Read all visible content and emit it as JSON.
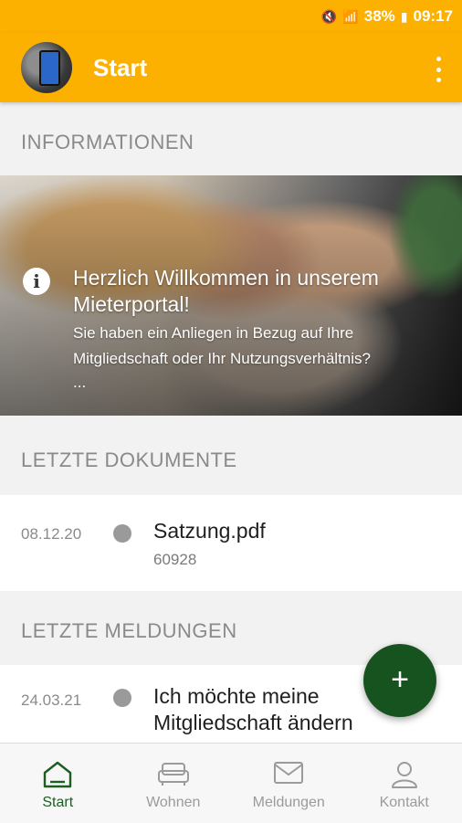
{
  "status": {
    "battery": "38%",
    "time": "09:17"
  },
  "appbar": {
    "title": "Start"
  },
  "sections": {
    "informationen": "INFORMATIONEN",
    "dokumente": "LETZTE DOKUMENTE",
    "meldungen": "LETZTE MELDUNGEN"
  },
  "hero": {
    "title": "Herzlich Willkommen in unserem Mieterportal!",
    "text": "Sie haben ein Anliegen in Bezug auf Ihre Mitgliedschaft oder Ihr Nutzungsverhältnis?",
    "ellipsis": "..."
  },
  "documents": [
    {
      "date": "08.12.20",
      "title": "Satzung.pdf",
      "sub": "60928"
    }
  ],
  "messages": [
    {
      "date": "24.03.21",
      "title": "Ich möchte meine Mitgliedschaft ändern"
    }
  ],
  "fab": {
    "label": "+"
  },
  "nav": [
    {
      "label": "Start",
      "icon": "home-icon",
      "active": true
    },
    {
      "label": "Wohnen",
      "icon": "sofa-icon",
      "active": false
    },
    {
      "label": "Meldungen",
      "icon": "mail-icon",
      "active": false
    },
    {
      "label": "Kontakt",
      "icon": "person-icon",
      "active": false
    }
  ],
  "colors": {
    "primary": "#fcb000",
    "accent": "#17531e"
  }
}
